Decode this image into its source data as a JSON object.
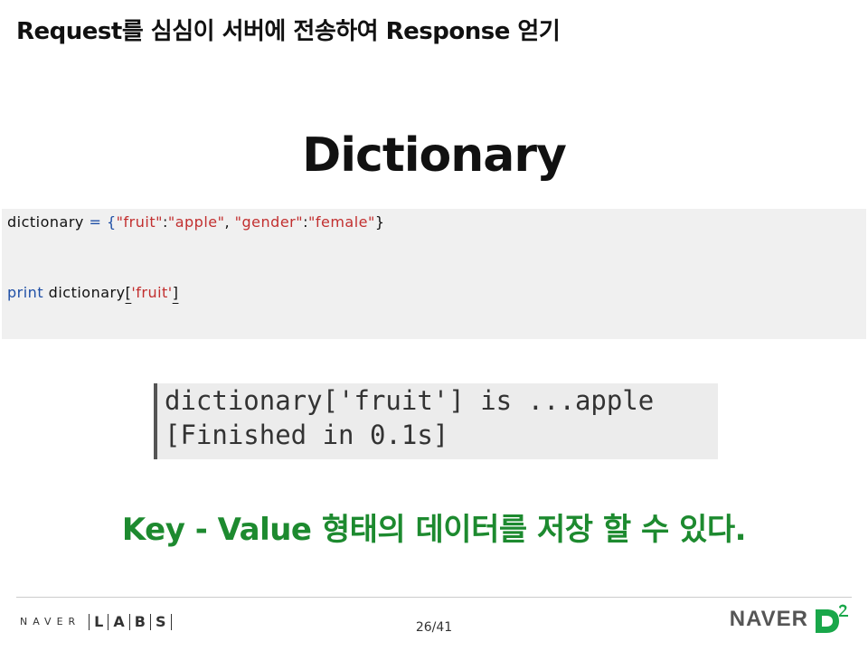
{
  "header": {
    "title": "Request를 심심이 서버에 전송하여 Response 얻기"
  },
  "section": {
    "title": "Dictionary"
  },
  "code": {
    "line1": {
      "var": "dictionary",
      "op": " = {",
      "k1": "\"fruit\"",
      "colon1": ":",
      "v1": "\"apple\"",
      "comma": ", ",
      "k2": "\"gender\"",
      "colon2": ":",
      "v2": "\"female\"",
      "close": "}"
    },
    "line2": {
      "keyword": "print",
      "var": " dictionary",
      "open": "[",
      "key": "'fruit'",
      "close": "]"
    }
  },
  "output": {
    "line1": "dictionary['fruit'] is ...apple",
    "line2": "[Finished in 0.1s]"
  },
  "note": {
    "text": "Key - Value 형태의 데이터를 저장 할 수 있다."
  },
  "footer": {
    "left_logo": {
      "brand": "NAVER",
      "letters": [
        "L",
        "A",
        "B",
        "S"
      ]
    },
    "page": "26/41",
    "right_logo": {
      "brand": "NAVER",
      "mark": "D2"
    }
  },
  "colors": {
    "keyword": "#1f4fa6",
    "string": "#c22f2f",
    "note": "#1d8a2f",
    "d2_accent": "#19a74a"
  }
}
